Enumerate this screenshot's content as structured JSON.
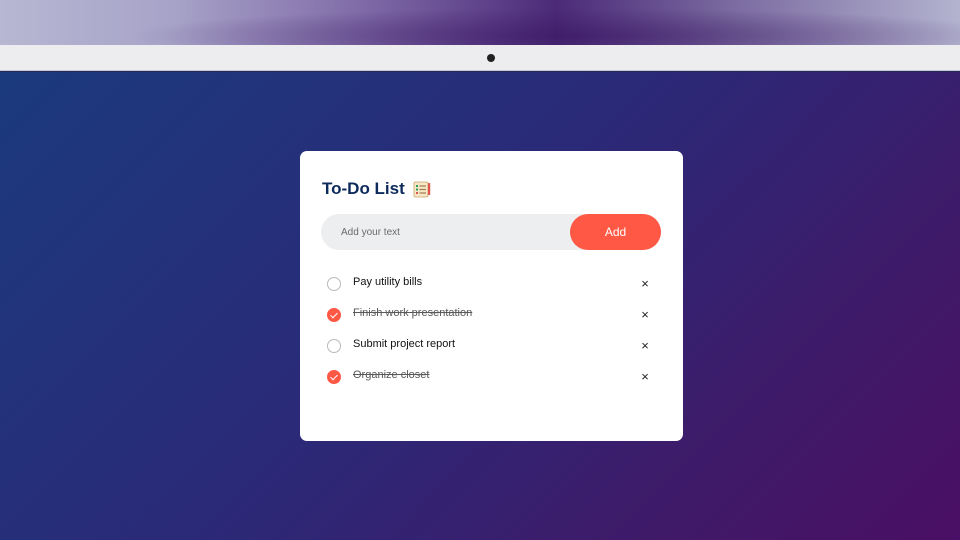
{
  "app": {
    "title": "To-Do List",
    "title_icon": "checklist-icon"
  },
  "input": {
    "placeholder": "Add your text",
    "value": ""
  },
  "add_button": {
    "label": "Add"
  },
  "tasks": [
    {
      "text": "Pay utility bills",
      "done": false
    },
    {
      "text": "Finish work presentation",
      "done": true
    },
    {
      "text": "Submit project report",
      "done": false
    },
    {
      "text": "Organize closet",
      "done": true
    }
  ],
  "delete_label": "×",
  "colors": {
    "accent": "#ff5945",
    "title": "#0d2a5c",
    "background_start": "#1b3a7e",
    "background_end": "#4a0f66",
    "card": "#ffffff"
  }
}
